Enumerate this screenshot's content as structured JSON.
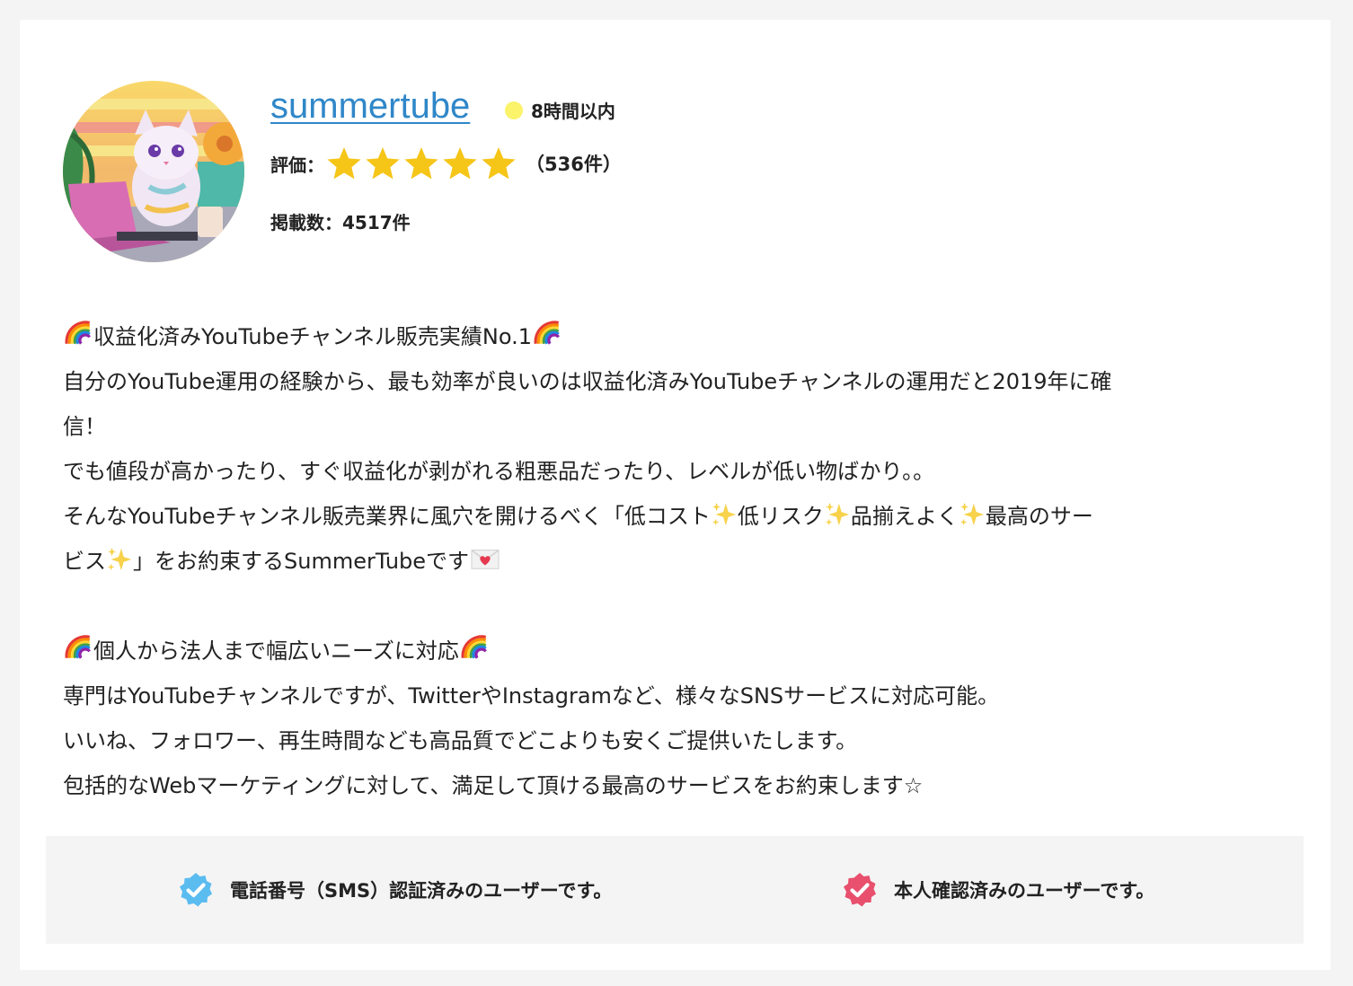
{
  "profile": {
    "username": "summertube",
    "response_time": "8時間以内",
    "rating_label": "評価：",
    "rating_stars": 5,
    "rating_max": 5,
    "rating_count": "（536件）",
    "listing_count": "掲載数：4517件",
    "colors": {
      "username": "#2f87c8",
      "star": "#f5c518",
      "status_dot": "#fbf36a"
    }
  },
  "description": {
    "lines": [
      "収益化済みYouTubeチャンネル販売実績No.1",
      "自分のYouTube運用の経験から、最も効率が良いのは収益化済みYouTubeチャンネルの運用だと2019年に確",
      "信！",
      "でも値段が高かったり、すぐ収益化が剥がれる粗悪品だったり、レベルが低い物ばかり。。",
      "そんなYouTubeチャンネル販売業界に風穴を開けるべく「低コスト",
      "低リスク",
      "品揃えよく",
      "最高のサー",
      "ビス",
      "」をお約束するSummerTubeです",
      "個人から法人まで幅広いニーズに対応",
      "専門はYouTubeチャンネルですが、TwitterやInstagramなど、様々なSNSサービスに対応可能。",
      "いいね、フォロワー、再生時間なども高品質でどこよりも安くご提供いたします。",
      "包括的なWebマーケティングに対して、満足して頂ける最高のサービスをお約束します☆"
    ]
  },
  "verification": {
    "phone": "電話番号（SMS）認証済みのユーザーです。",
    "identity": "本人確認済みのユーザーです。",
    "colors": {
      "phone_badge": "#5bbcf0",
      "identity_badge": "#e8506e"
    }
  },
  "icons": {
    "avatar": "cat-avatar-image",
    "rainbow": "rainbow-icon",
    "sparkles": "sparkles-icon",
    "love_letter": "love-letter-icon",
    "phone_badge": "check-badge-icon",
    "identity_badge": "check-badge-icon"
  }
}
